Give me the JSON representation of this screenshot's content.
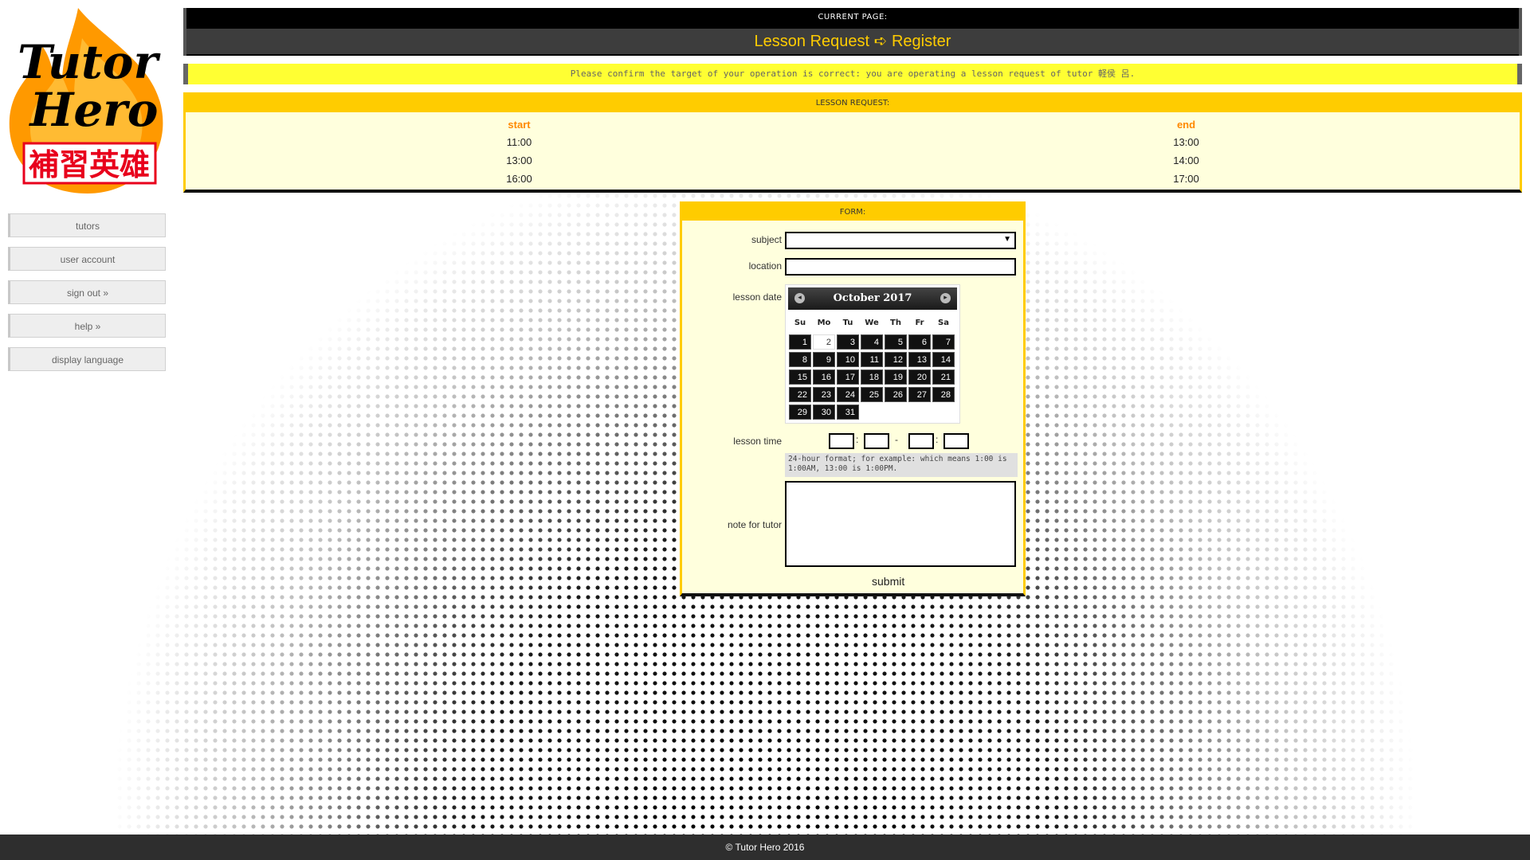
{
  "logo": {
    "line1": "Tutor",
    "line2": "Hero",
    "chinese": "補習英雄"
  },
  "sidebar": {
    "items": [
      {
        "label": "tutors"
      },
      {
        "label": "user account"
      },
      {
        "label": "sign out »"
      },
      {
        "label": "help »"
      },
      {
        "label": "display language"
      }
    ]
  },
  "header": {
    "current_label": "CURRENT PAGE:",
    "current_page": "Lesson Request ➪ Register"
  },
  "notice": "Please confirm the target of your operation is correct: you are operating a lesson request of tutor 軽侯 呂.",
  "lesson_request": {
    "title": "LESSON REQUEST:",
    "headers": {
      "start": "start",
      "end": "end"
    },
    "rows": [
      {
        "start": "11:00",
        "end": "13:00"
      },
      {
        "start": "13:00",
        "end": "14:00"
      },
      {
        "start": "16:00",
        "end": "17:00"
      }
    ]
  },
  "form": {
    "title": "FORM:",
    "subject_label": "subject",
    "location_label": "location",
    "lesson_date_label": "lesson date",
    "lesson_time_label": "lesson time",
    "time_separator": "-",
    "hint": "24-hour format; for example: which means 1:00 is 1:00AM, 13:00 is 1:00PM.",
    "note_label": "note for tutor",
    "submit_label": "submit"
  },
  "calendar": {
    "month_label": "October 2017",
    "prev_icon": "◂",
    "next_icon": "▸",
    "weekdays": [
      "Su",
      "Mo",
      "Tu",
      "We",
      "Th",
      "Fr",
      "Sa"
    ],
    "days_in_month": 31,
    "first_weekday": 0,
    "today": 2
  },
  "footer": "© Tutor Hero 2016",
  "colors": {
    "accent": "#ffcc00",
    "notice": "#ffff33",
    "logo_red": "#e8001c",
    "flame": "#ff9900"
  }
}
